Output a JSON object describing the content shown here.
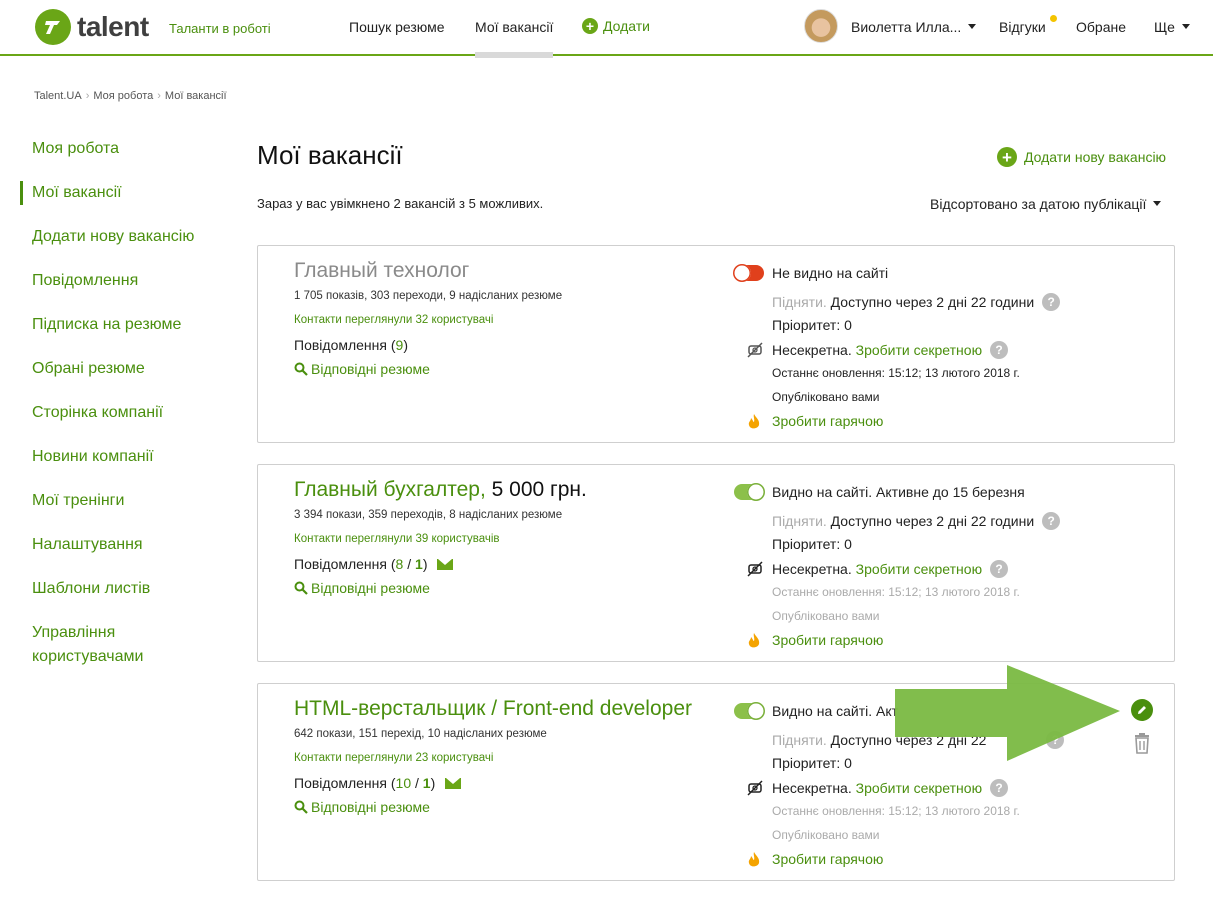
{
  "header": {
    "logo_text": "talent",
    "tagline": "Таланти в роботі",
    "nav": {
      "search": "Пошук резюме",
      "my_vacancies": "Мої вакансії",
      "add": "Додати"
    },
    "user_name": "Виолетта Илла...",
    "responses": "Відгуки",
    "favorites": "Обране",
    "more": "Ще",
    "accent_color": "#6aa617"
  },
  "breadcrumb": [
    "Talent.UA",
    "Моя робота",
    "Мої вакансії"
  ],
  "sidebar": {
    "items": [
      "Моя робота",
      "Мої вакансії",
      "Додати нову вакансію",
      "Повідомлення",
      "Підписка на резюме",
      "Обрані резюме",
      "Сторінка компанії",
      "Новини компанії",
      "Мої тренінги",
      "Налаштування",
      "Шаблони листів",
      "Управління користувачами"
    ],
    "active_index": 1
  },
  "main": {
    "title": "Мої вакансії",
    "add_new": "Додати нову вакансію",
    "summary": "Зараз у вас увімкнено 2 вакансій з 5 можливих.",
    "sort_label": "Відсортовано за датою публікації"
  },
  "labels": {
    "messages": "Повідомлення",
    "matching_resumes": "Відповідні резюме",
    "raise": "Підняти.",
    "priority": "Пріоритет: 0",
    "not_secret": "Несекретна.",
    "make_secret": "Зробити секретною",
    "published_by_you": "Опубліковано вами",
    "make_hot": "Зробити гарячою",
    "question_mark": "?"
  },
  "vacancies": [
    {
      "title": "Главный технолог",
      "salary": "",
      "stats": "1 705 показів, 303 переходи, 9 надісланих резюме",
      "contacts": "Контакти переглянули 32 користувачі",
      "messages_a": "9",
      "messages_b": "",
      "visibility": "Не видно на сайті",
      "raise_available": "Доступно через 2 дні 22 години",
      "last_update": "Останнє оновлення: 15:12; 13 лютого 2018 г."
    },
    {
      "title": "Главный бухгалтер,",
      "salary": "5 000 грн.",
      "stats": "3 394 покази, 359 переходів, 8 надісланих резюме",
      "contacts": "Контакти переглянули 39 користувачів",
      "messages_a": "8",
      "messages_b": "1",
      "visibility": "Видно на сайті. Активне до 15 березня",
      "raise_available": "Доступно через 2 дні 22 години",
      "last_update": "Останнє оновлення: 15:12; 13 лютого 2018 г."
    },
    {
      "title": "HTML-верстальщик / Front-end developer",
      "salary": "",
      "stats": "642 покази, 151 перехід, 10 надісланих резюме",
      "contacts": "Контакти переглянули 23 користувачі",
      "messages_a": "10",
      "messages_b": "1",
      "visibility": "Видно на сайті. Акт",
      "raise_available": "Доступно через 2 дні 22",
      "last_update": "Останнє оновлення: 15:12; 13 лютого 2018 г."
    }
  ]
}
